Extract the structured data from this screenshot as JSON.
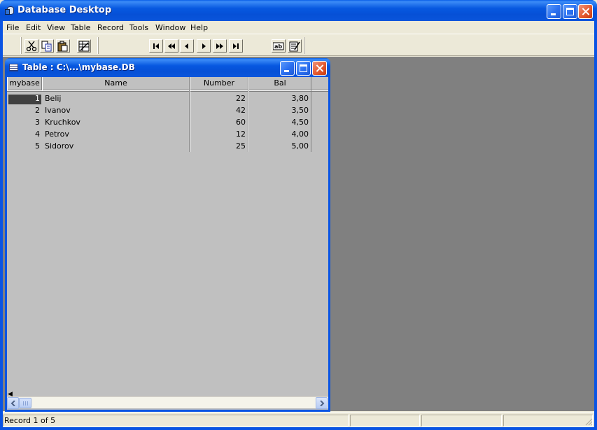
{
  "window": {
    "title": "Database Desktop"
  },
  "menubar": {
    "items": [
      "File",
      "Edit",
      "View",
      "Table",
      "Record",
      "Tools",
      "Window",
      "Help"
    ]
  },
  "toolbar": {
    "buttons": [
      "cut",
      "copy",
      "paste",
      "restructure",
      "first-record",
      "previous-set",
      "previous-record",
      "next-record",
      "next-set",
      "last-record",
      "field-view",
      "edit-data"
    ]
  },
  "child_window": {
    "title": "Table : C:\\...\\mybase.DB",
    "columns": [
      "mybase",
      "Name",
      "Number",
      "Bal"
    ],
    "rows": [
      {
        "id": "1",
        "name": "Belij",
        "number": "22",
        "bal": "3,80"
      },
      {
        "id": "2",
        "name": "Ivanov",
        "number": "42",
        "bal": "3,50"
      },
      {
        "id": "3",
        "name": "Kruchkov",
        "number": "60",
        "bal": "4,50"
      },
      {
        "id": "4",
        "name": "Petrov",
        "number": "12",
        "bal": "4,00"
      },
      {
        "id": "5",
        "name": "Sidorov",
        "number": "25",
        "bal": "5,00"
      }
    ],
    "current_record": 1
  },
  "statusbar": {
    "text": "Record 1 of 5"
  },
  "colors": {
    "title_bar": "#0a54e3",
    "mdi_background": "#808080",
    "grid_background": "#c0c0c0",
    "close_button": "#e45a2f"
  }
}
